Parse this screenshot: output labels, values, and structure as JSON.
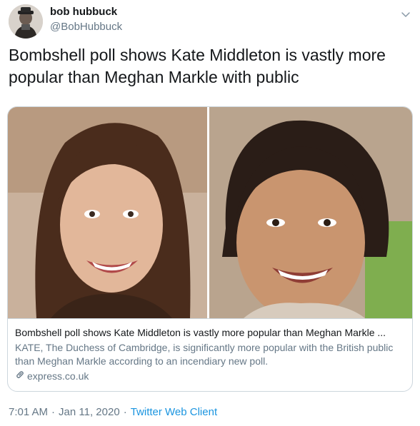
{
  "author": {
    "name": "bob hubbuck",
    "handle": "@BobHubbuck"
  },
  "tweet": {
    "text": "Bombshell poll shows Kate Middleton is vastly more popular than Meghan Markle with public"
  },
  "card": {
    "title": "Bombshell poll shows Kate Middleton is vastly more popular than Meghan Markle ...",
    "description": "KATE, The Duchess of Cambridge, is significantly more popular with the British public than Meghan Markle according to an incendiary new poll.",
    "domain": "express.co.uk",
    "link_icon": "link-icon"
  },
  "meta": {
    "time": "7:01 AM",
    "separator": "·",
    "date": "Jan 11, 2020",
    "client": "Twitter Web Client"
  },
  "icons": {
    "caret": "chevron-down-icon"
  },
  "colors": {
    "link_blue": "#1b95e0",
    "secondary_text": "#657786",
    "border": "#ccd6dd"
  }
}
